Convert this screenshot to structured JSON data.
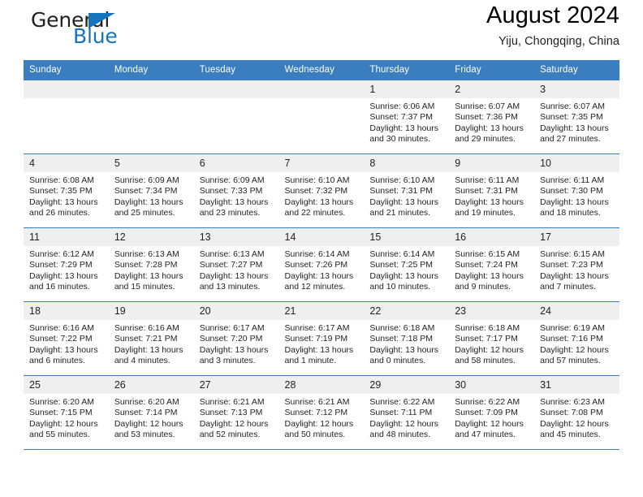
{
  "logo": {
    "word_one": "General",
    "word_two": "Blue",
    "triangle_icon": "triangle-icon",
    "brand_color": "#1574bb"
  },
  "header": {
    "title": "August 2024",
    "location": "Yiju, Chongqing, China"
  },
  "theme": {
    "header_row_bg": "#3a7ec0",
    "daynum_bg": "#efefef",
    "text": "#231f20"
  },
  "weekday_headers": [
    "Sunday",
    "Monday",
    "Tuesday",
    "Wednesday",
    "Thursday",
    "Friday",
    "Saturday"
  ],
  "labels": {
    "sunrise": "Sunrise:",
    "sunset": "Sunset:",
    "daylight": "Daylight:"
  },
  "weeks": [
    [
      {
        "day": "",
        "empty": true
      },
      {
        "day": "",
        "empty": true
      },
      {
        "day": "",
        "empty": true
      },
      {
        "day": "",
        "empty": true
      },
      {
        "day": "1",
        "sunrise": "Sunrise: 6:06 AM",
        "sunset": "Sunset: 7:37 PM",
        "daylight_line1": "Daylight: 13 hours",
        "daylight_line2": "and 30 minutes."
      },
      {
        "day": "2",
        "sunrise": "Sunrise: 6:07 AM",
        "sunset": "Sunset: 7:36 PM",
        "daylight_line1": "Daylight: 13 hours",
        "daylight_line2": "and 29 minutes."
      },
      {
        "day": "3",
        "sunrise": "Sunrise: 6:07 AM",
        "sunset": "Sunset: 7:35 PM",
        "daylight_line1": "Daylight: 13 hours",
        "daylight_line2": "and 27 minutes."
      }
    ],
    [
      {
        "day": "4",
        "sunrise": "Sunrise: 6:08 AM",
        "sunset": "Sunset: 7:35 PM",
        "daylight_line1": "Daylight: 13 hours",
        "daylight_line2": "and 26 minutes."
      },
      {
        "day": "5",
        "sunrise": "Sunrise: 6:09 AM",
        "sunset": "Sunset: 7:34 PM",
        "daylight_line1": "Daylight: 13 hours",
        "daylight_line2": "and 25 minutes."
      },
      {
        "day": "6",
        "sunrise": "Sunrise: 6:09 AM",
        "sunset": "Sunset: 7:33 PM",
        "daylight_line1": "Daylight: 13 hours",
        "daylight_line2": "and 23 minutes."
      },
      {
        "day": "7",
        "sunrise": "Sunrise: 6:10 AM",
        "sunset": "Sunset: 7:32 PM",
        "daylight_line1": "Daylight: 13 hours",
        "daylight_line2": "and 22 minutes."
      },
      {
        "day": "8",
        "sunrise": "Sunrise: 6:10 AM",
        "sunset": "Sunset: 7:31 PM",
        "daylight_line1": "Daylight: 13 hours",
        "daylight_line2": "and 21 minutes."
      },
      {
        "day": "9",
        "sunrise": "Sunrise: 6:11 AM",
        "sunset": "Sunset: 7:31 PM",
        "daylight_line1": "Daylight: 13 hours",
        "daylight_line2": "and 19 minutes."
      },
      {
        "day": "10",
        "sunrise": "Sunrise: 6:11 AM",
        "sunset": "Sunset: 7:30 PM",
        "daylight_line1": "Daylight: 13 hours",
        "daylight_line2": "and 18 minutes."
      }
    ],
    [
      {
        "day": "11",
        "sunrise": "Sunrise: 6:12 AM",
        "sunset": "Sunset: 7:29 PM",
        "daylight_line1": "Daylight: 13 hours",
        "daylight_line2": "and 16 minutes."
      },
      {
        "day": "12",
        "sunrise": "Sunrise: 6:13 AM",
        "sunset": "Sunset: 7:28 PM",
        "daylight_line1": "Daylight: 13 hours",
        "daylight_line2": "and 15 minutes."
      },
      {
        "day": "13",
        "sunrise": "Sunrise: 6:13 AM",
        "sunset": "Sunset: 7:27 PM",
        "daylight_line1": "Daylight: 13 hours",
        "daylight_line2": "and 13 minutes."
      },
      {
        "day": "14",
        "sunrise": "Sunrise: 6:14 AM",
        "sunset": "Sunset: 7:26 PM",
        "daylight_line1": "Daylight: 13 hours",
        "daylight_line2": "and 12 minutes."
      },
      {
        "day": "15",
        "sunrise": "Sunrise: 6:14 AM",
        "sunset": "Sunset: 7:25 PM",
        "daylight_line1": "Daylight: 13 hours",
        "daylight_line2": "and 10 minutes."
      },
      {
        "day": "16",
        "sunrise": "Sunrise: 6:15 AM",
        "sunset": "Sunset: 7:24 PM",
        "daylight_line1": "Daylight: 13 hours",
        "daylight_line2": "and 9 minutes."
      },
      {
        "day": "17",
        "sunrise": "Sunrise: 6:15 AM",
        "sunset": "Sunset: 7:23 PM",
        "daylight_line1": "Daylight: 13 hours",
        "daylight_line2": "and 7 minutes."
      }
    ],
    [
      {
        "day": "18",
        "sunrise": "Sunrise: 6:16 AM",
        "sunset": "Sunset: 7:22 PM",
        "daylight_line1": "Daylight: 13 hours",
        "daylight_line2": "and 6 minutes."
      },
      {
        "day": "19",
        "sunrise": "Sunrise: 6:16 AM",
        "sunset": "Sunset: 7:21 PM",
        "daylight_line1": "Daylight: 13 hours",
        "daylight_line2": "and 4 minutes."
      },
      {
        "day": "20",
        "sunrise": "Sunrise: 6:17 AM",
        "sunset": "Sunset: 7:20 PM",
        "daylight_line1": "Daylight: 13 hours",
        "daylight_line2": "and 3 minutes."
      },
      {
        "day": "21",
        "sunrise": "Sunrise: 6:17 AM",
        "sunset": "Sunset: 7:19 PM",
        "daylight_line1": "Daylight: 13 hours",
        "daylight_line2": "and 1 minute."
      },
      {
        "day": "22",
        "sunrise": "Sunrise: 6:18 AM",
        "sunset": "Sunset: 7:18 PM",
        "daylight_line1": "Daylight: 13 hours",
        "daylight_line2": "and 0 minutes."
      },
      {
        "day": "23",
        "sunrise": "Sunrise: 6:18 AM",
        "sunset": "Sunset: 7:17 PM",
        "daylight_line1": "Daylight: 12 hours",
        "daylight_line2": "and 58 minutes."
      },
      {
        "day": "24",
        "sunrise": "Sunrise: 6:19 AM",
        "sunset": "Sunset: 7:16 PM",
        "daylight_line1": "Daylight: 12 hours",
        "daylight_line2": "and 57 minutes."
      }
    ],
    [
      {
        "day": "25",
        "sunrise": "Sunrise: 6:20 AM",
        "sunset": "Sunset: 7:15 PM",
        "daylight_line1": "Daylight: 12 hours",
        "daylight_line2": "and 55 minutes."
      },
      {
        "day": "26",
        "sunrise": "Sunrise: 6:20 AM",
        "sunset": "Sunset: 7:14 PM",
        "daylight_line1": "Daylight: 12 hours",
        "daylight_line2": "and 53 minutes."
      },
      {
        "day": "27",
        "sunrise": "Sunrise: 6:21 AM",
        "sunset": "Sunset: 7:13 PM",
        "daylight_line1": "Daylight: 12 hours",
        "daylight_line2": "and 52 minutes."
      },
      {
        "day": "28",
        "sunrise": "Sunrise: 6:21 AM",
        "sunset": "Sunset: 7:12 PM",
        "daylight_line1": "Daylight: 12 hours",
        "daylight_line2": "and 50 minutes."
      },
      {
        "day": "29",
        "sunrise": "Sunrise: 6:22 AM",
        "sunset": "Sunset: 7:11 PM",
        "daylight_line1": "Daylight: 12 hours",
        "daylight_line2": "and 48 minutes."
      },
      {
        "day": "30",
        "sunrise": "Sunrise: 6:22 AM",
        "sunset": "Sunset: 7:09 PM",
        "daylight_line1": "Daylight: 12 hours",
        "daylight_line2": "and 47 minutes."
      },
      {
        "day": "31",
        "sunrise": "Sunrise: 6:23 AM",
        "sunset": "Sunset: 7:08 PM",
        "daylight_line1": "Daylight: 12 hours",
        "daylight_line2": "and 45 minutes."
      }
    ]
  ]
}
